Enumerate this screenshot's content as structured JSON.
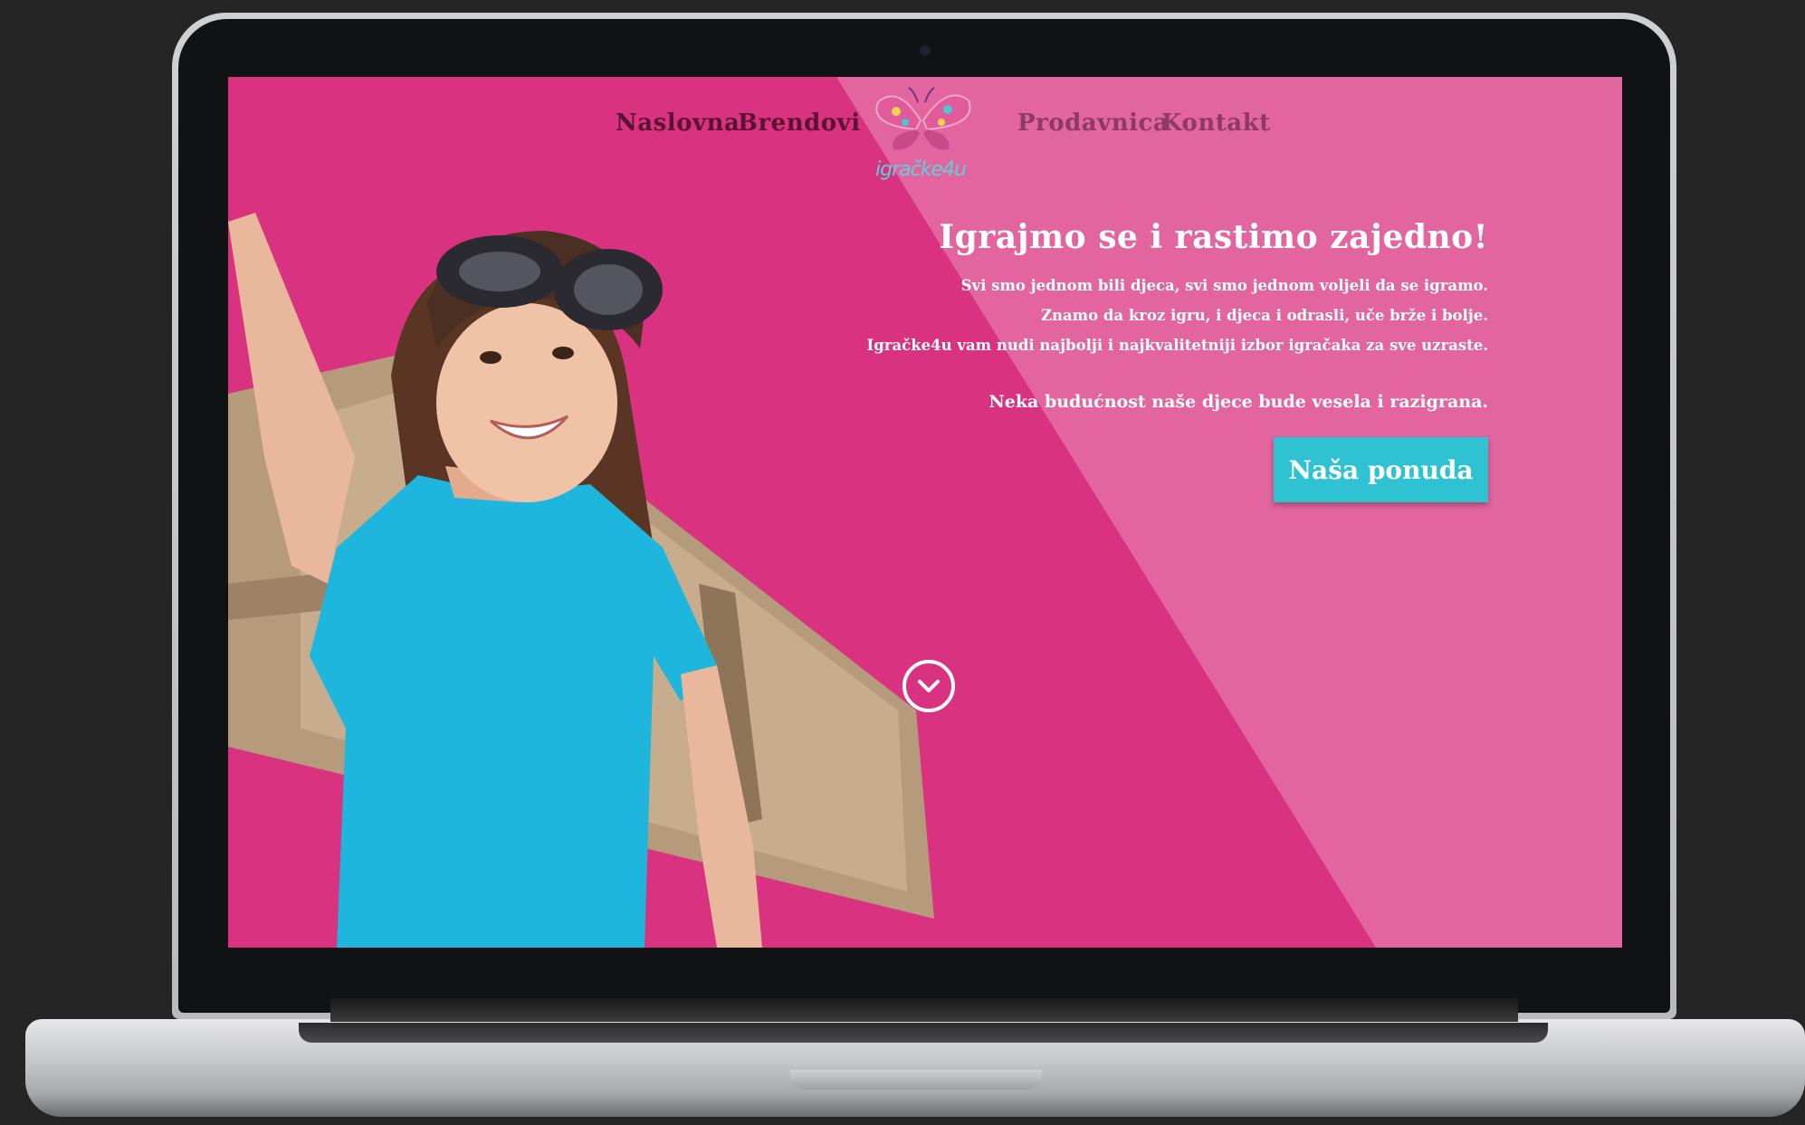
{
  "nav": {
    "items": [
      {
        "label": "Naslovna"
      },
      {
        "label": "Brendovi"
      },
      {
        "label": "Prodavnica"
      },
      {
        "label": "Kontakt"
      }
    ],
    "logo_text": "igračke4u"
  },
  "hero": {
    "title": "Igrajmo se i rastimo zajedno!",
    "lines": [
      "Svi smo jednom bili djeca,  svi smo jednom voljeli da se igramo.",
      "Znamo da kroz igru, i djeca i odrasli, uče brže i bolje.",
      "Igračke4u vam nudi najbolji i najkvalitetniji izbor igračaka za sve uzraste."
    ],
    "tagline": "Neka budućnost naše djece bude vesela i razigrana.",
    "cta_label": "Naša ponuda"
  },
  "colors": {
    "background": "#d93280",
    "cta": "#2ec2d2",
    "nav_text": "#5c1232",
    "hero_text": "#ffffff"
  },
  "icons": {
    "scroll": "chevron-down-icon",
    "logo": "butterfly-icon"
  }
}
